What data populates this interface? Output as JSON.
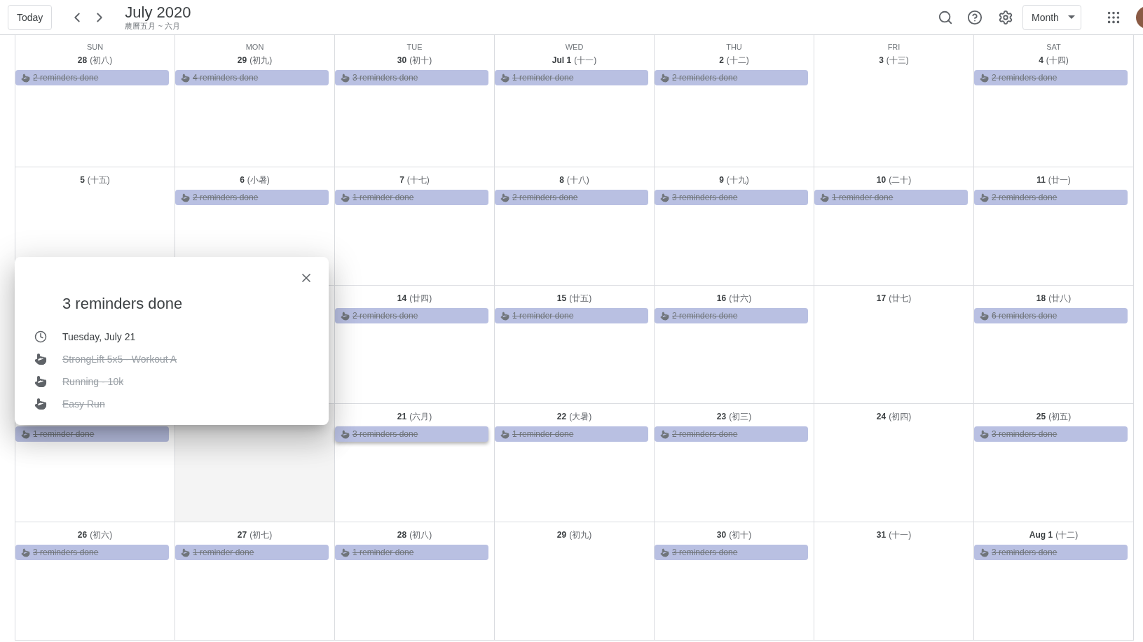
{
  "header": {
    "today_button": "Today",
    "title": "July 2020",
    "subtitle": "農曆五月 ~ 六月",
    "view_select": "Month"
  },
  "weekdays": [
    "SUN",
    "MON",
    "TUE",
    "WED",
    "THU",
    "FRI",
    "SAT"
  ],
  "weeks": [
    {
      "days": [
        {
          "date": "28",
          "lunar": "(初八)",
          "chips": [
            {
              "text": "2 reminders done",
              "selected": false
            }
          ]
        },
        {
          "date": "29",
          "lunar": "(初九)",
          "chips": [
            {
              "text": "4 reminders done",
              "selected": false
            }
          ]
        },
        {
          "date": "30",
          "lunar": "(初十)",
          "chips": [
            {
              "text": "3 reminders done",
              "selected": false
            }
          ]
        },
        {
          "date": "Jul 1",
          "lunar": "(十一)",
          "chips": [
            {
              "text": "1 reminder done",
              "selected": false
            }
          ]
        },
        {
          "date": "2",
          "lunar": "(十二)",
          "chips": [
            {
              "text": "2 reminders done",
              "selected": false
            }
          ]
        },
        {
          "date": "3",
          "lunar": "(十三)"
        },
        {
          "date": "4",
          "lunar": "(十四)",
          "chips": [
            {
              "text": "2 reminders done",
              "selected": false
            }
          ]
        }
      ]
    },
    {
      "days": [
        {
          "date": "5",
          "lunar": "(十五)"
        },
        {
          "date": "6",
          "lunar": "(小暑)",
          "chips": [
            {
              "text": "2 reminders done",
              "selected": false
            }
          ]
        },
        {
          "date": "7",
          "lunar": "(十七)",
          "chips": [
            {
              "text": "1 reminder done",
              "selected": false
            }
          ]
        },
        {
          "date": "8",
          "lunar": "(十八)",
          "chips": [
            {
              "text": "2 reminders done",
              "selected": false
            }
          ]
        },
        {
          "date": "9",
          "lunar": "(十九)",
          "chips": [
            {
              "text": "3 reminders done",
              "selected": false
            }
          ]
        },
        {
          "date": "10",
          "lunar": "(二十)",
          "chips": [
            {
              "text": "1 reminder done",
              "selected": false
            }
          ]
        },
        {
          "date": "11",
          "lunar": "(廿一)",
          "chips": [
            {
              "text": "2 reminders done",
              "selected": false
            }
          ]
        }
      ]
    },
    {
      "days": [
        {
          "date": "14",
          "lunar": "(廿四)",
          "chips": [
            {
              "text": "2 reminders done",
              "selected": false
            }
          ]
        },
        {
          "date": "15",
          "lunar": "(廿五)",
          "chips": [
            {
              "text": "1 reminder done",
              "selected": false
            }
          ]
        },
        {
          "date": "16",
          "lunar": "(廿六)",
          "chips": [
            {
              "text": "2 reminders done",
              "selected": false
            }
          ]
        },
        {
          "date": "17",
          "lunar": "(廿七)"
        },
        {
          "date": "18",
          "lunar": "(廿八)",
          "chips": [
            {
              "text": "6 reminders done",
              "selected": false
            }
          ]
        }
      ]
    },
    {
      "days": [
        {
          "chips": [
            {
              "text": "1 reminder done",
              "selected": false
            }
          ]
        },
        {
          "covered": true
        },
        {
          "date": "21",
          "lunar": "(六月)",
          "chips": [
            {
              "text": "3 reminders done",
              "selected": true
            }
          ]
        },
        {
          "date": "22",
          "lunar": "(大暑)",
          "chips": [
            {
              "text": "1 reminder done",
              "selected": false
            }
          ]
        },
        {
          "date": "23",
          "lunar": "(初三)",
          "chips": [
            {
              "text": "2 reminders done",
              "selected": false
            }
          ]
        },
        {
          "date": "24",
          "lunar": "(初四)"
        },
        {
          "date": "25",
          "lunar": "(初五)",
          "chips": [
            {
              "text": "3 reminders done",
              "selected": false
            }
          ]
        }
      ]
    },
    {
      "days": [
        {
          "date": "26",
          "lunar": "(初六)",
          "chips": [
            {
              "text": "3 reminders done",
              "selected": false
            }
          ]
        },
        {
          "date": "27",
          "lunar": "(初七)",
          "chips": [
            {
              "text": "1 reminder done",
              "selected": false
            }
          ]
        },
        {
          "date": "28",
          "lunar": "(初八)",
          "chips": [
            {
              "text": "1 reminder done",
              "selected": false
            }
          ]
        },
        {
          "date": "29",
          "lunar": "(初九)"
        },
        {
          "date": "30",
          "lunar": "(初十)",
          "chips": [
            {
              "text": "3 reminders done",
              "selected": false
            }
          ]
        },
        {
          "date": "31",
          "lunar": "(十一)"
        },
        {
          "date": "Aug 1",
          "lunar": "(十二)",
          "chips": [
            {
              "text": "3 reminders done",
              "selected": false
            }
          ]
        }
      ]
    }
  ],
  "popup": {
    "title": "3 reminders done",
    "date": "Tuesday, July 21",
    "items": [
      {
        "text": "StrongLift 5x5 - Workout A",
        "done": true
      },
      {
        "text": "Running - 10k",
        "done": true
      },
      {
        "text": "Easy Run",
        "done": true
      }
    ]
  }
}
